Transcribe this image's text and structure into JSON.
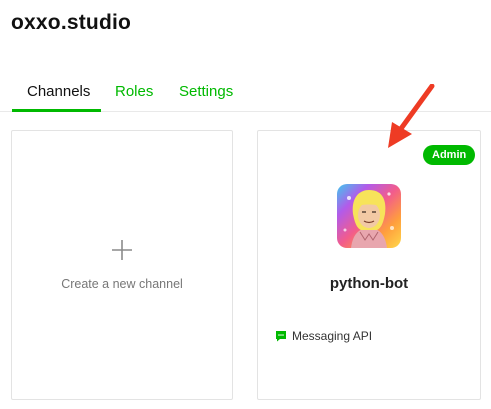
{
  "provider": {
    "name": "oxxo.studio"
  },
  "tabs": [
    {
      "label": "Channels",
      "active": true
    },
    {
      "label": "Roles",
      "active": false
    },
    {
      "label": "Settings",
      "active": false
    }
  ],
  "create_card": {
    "icon": "plus-icon",
    "label": "Create a new channel"
  },
  "channel_card": {
    "badge": "Admin",
    "avatar_icon": "channel-avatar",
    "name": "python-bot",
    "type_icon": "chat-bubble-icon",
    "type_label": "Messaging API"
  },
  "colors": {
    "accent": "#00b900",
    "annotation_arrow": "#ee3b24"
  }
}
